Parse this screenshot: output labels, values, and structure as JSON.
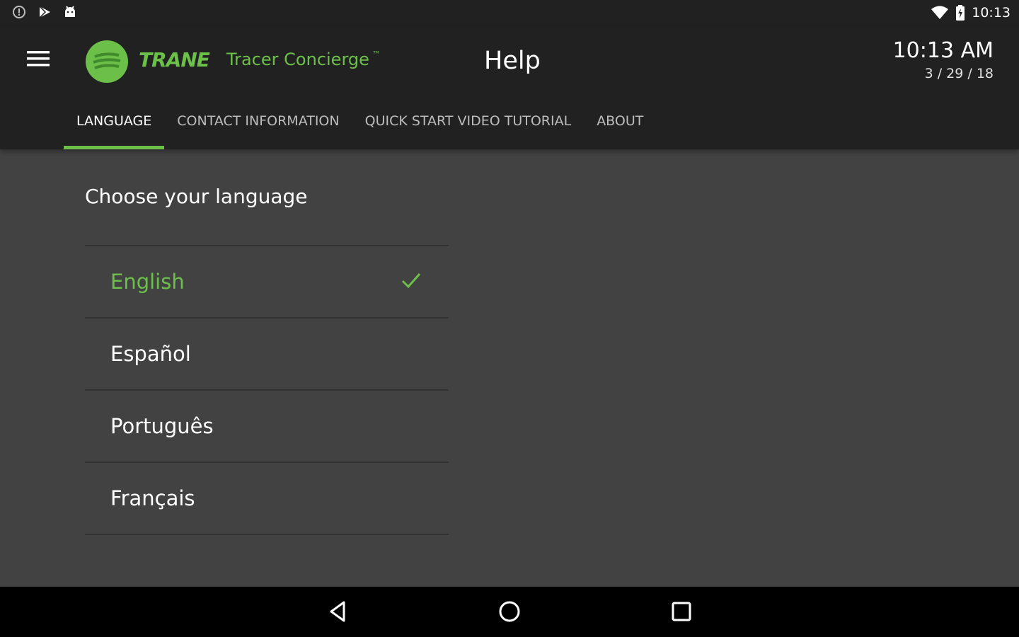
{
  "status_bar": {
    "time": "10:13",
    "left_icons": [
      "info-icon",
      "play-store-icon",
      "android-icon"
    ],
    "right_icons": [
      "wifi-icon",
      "battery-icon"
    ]
  },
  "header": {
    "brand": "TRANE",
    "product": "Tracer Concierge",
    "product_tm": "™",
    "title": "Help",
    "clock": "10:13 AM",
    "date": "3 / 29 / 18"
  },
  "tabs": [
    {
      "label": "LANGUAGE",
      "active": true
    },
    {
      "label": "CONTACT INFORMATION",
      "active": false
    },
    {
      "label": "QUICK START VIDEO TUTORIAL",
      "active": false
    },
    {
      "label": "ABOUT",
      "active": false
    }
  ],
  "language": {
    "heading": "Choose your language",
    "options": [
      {
        "label": "English",
        "selected": true
      },
      {
        "label": "Español",
        "selected": false
      },
      {
        "label": "Português",
        "selected": false
      },
      {
        "label": "Français",
        "selected": false
      }
    ]
  },
  "colors": {
    "accent": "#6cc04a",
    "appbar": "#212121",
    "background": "#424242",
    "navbar": "#000000"
  }
}
